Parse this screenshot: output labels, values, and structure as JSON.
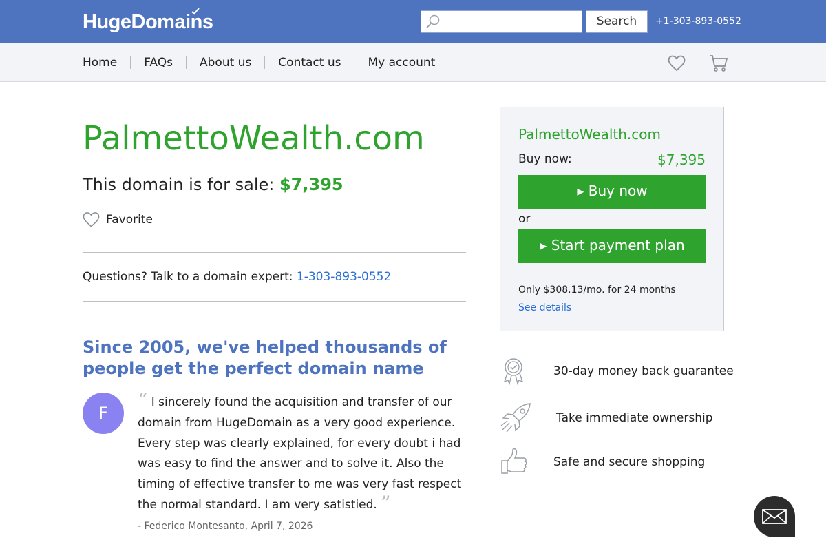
{
  "header": {
    "logo_text": "HugeDomains",
    "search": {
      "value": "",
      "placeholder": "",
      "button_label": "Search"
    },
    "phone": "+1-303-893-0552"
  },
  "nav": {
    "items": [
      "Home",
      "FAQs",
      "About us",
      "Contact us",
      "My account"
    ],
    "icons": [
      "heart-icon",
      "cart-icon"
    ]
  },
  "main": {
    "domain": "PalmettoWealth.com",
    "sale_prefix": "This domain is for sale: ",
    "sale_price": "$7,395",
    "favorite_label": "Favorite",
    "questions_text": "Questions? Talk to a domain expert: ",
    "questions_phone": "1-303-893-0552",
    "since_heading": "Since 2005, we've helped thousands of people get the perfect domain name",
    "testimonial": {
      "avatar_letter": "F",
      "text": "I sincerely found the acquisition and transfer of our domain from HugeDomain as a very good experience. Every step was clearly explained, for every doubt i had was easy to find the answer and to solve it. Also the timing of effective transfer to me was very fast respect the normal standard. I am very satistied.",
      "author": "- Federico Montesanto, April 7, 2026"
    }
  },
  "panel": {
    "domain": "PalmettoWealth.com",
    "buy_label": "Buy now:",
    "price": "$7,395",
    "buy_button": "▸ Buy now",
    "or_text": "or",
    "plan_button": "▸ Start payment plan",
    "monthly_text": "Only $308.13/mo. for 24 months",
    "details_link": "See details"
  },
  "features": [
    {
      "icon": "award-ribbon-icon",
      "label": "30-day money back guarantee"
    },
    {
      "icon": "rocket-icon",
      "label": "Take immediate ownership"
    },
    {
      "icon": "thumbs-up-icon",
      "label": "Safe and secure shopping"
    }
  ],
  "colors": {
    "header_blue": "#4f74bf",
    "green": "#2ea32e",
    "link_blue": "#2a6ed6",
    "heading_blue": "#4f74bf",
    "avatar_purple": "#8b82f2"
  }
}
